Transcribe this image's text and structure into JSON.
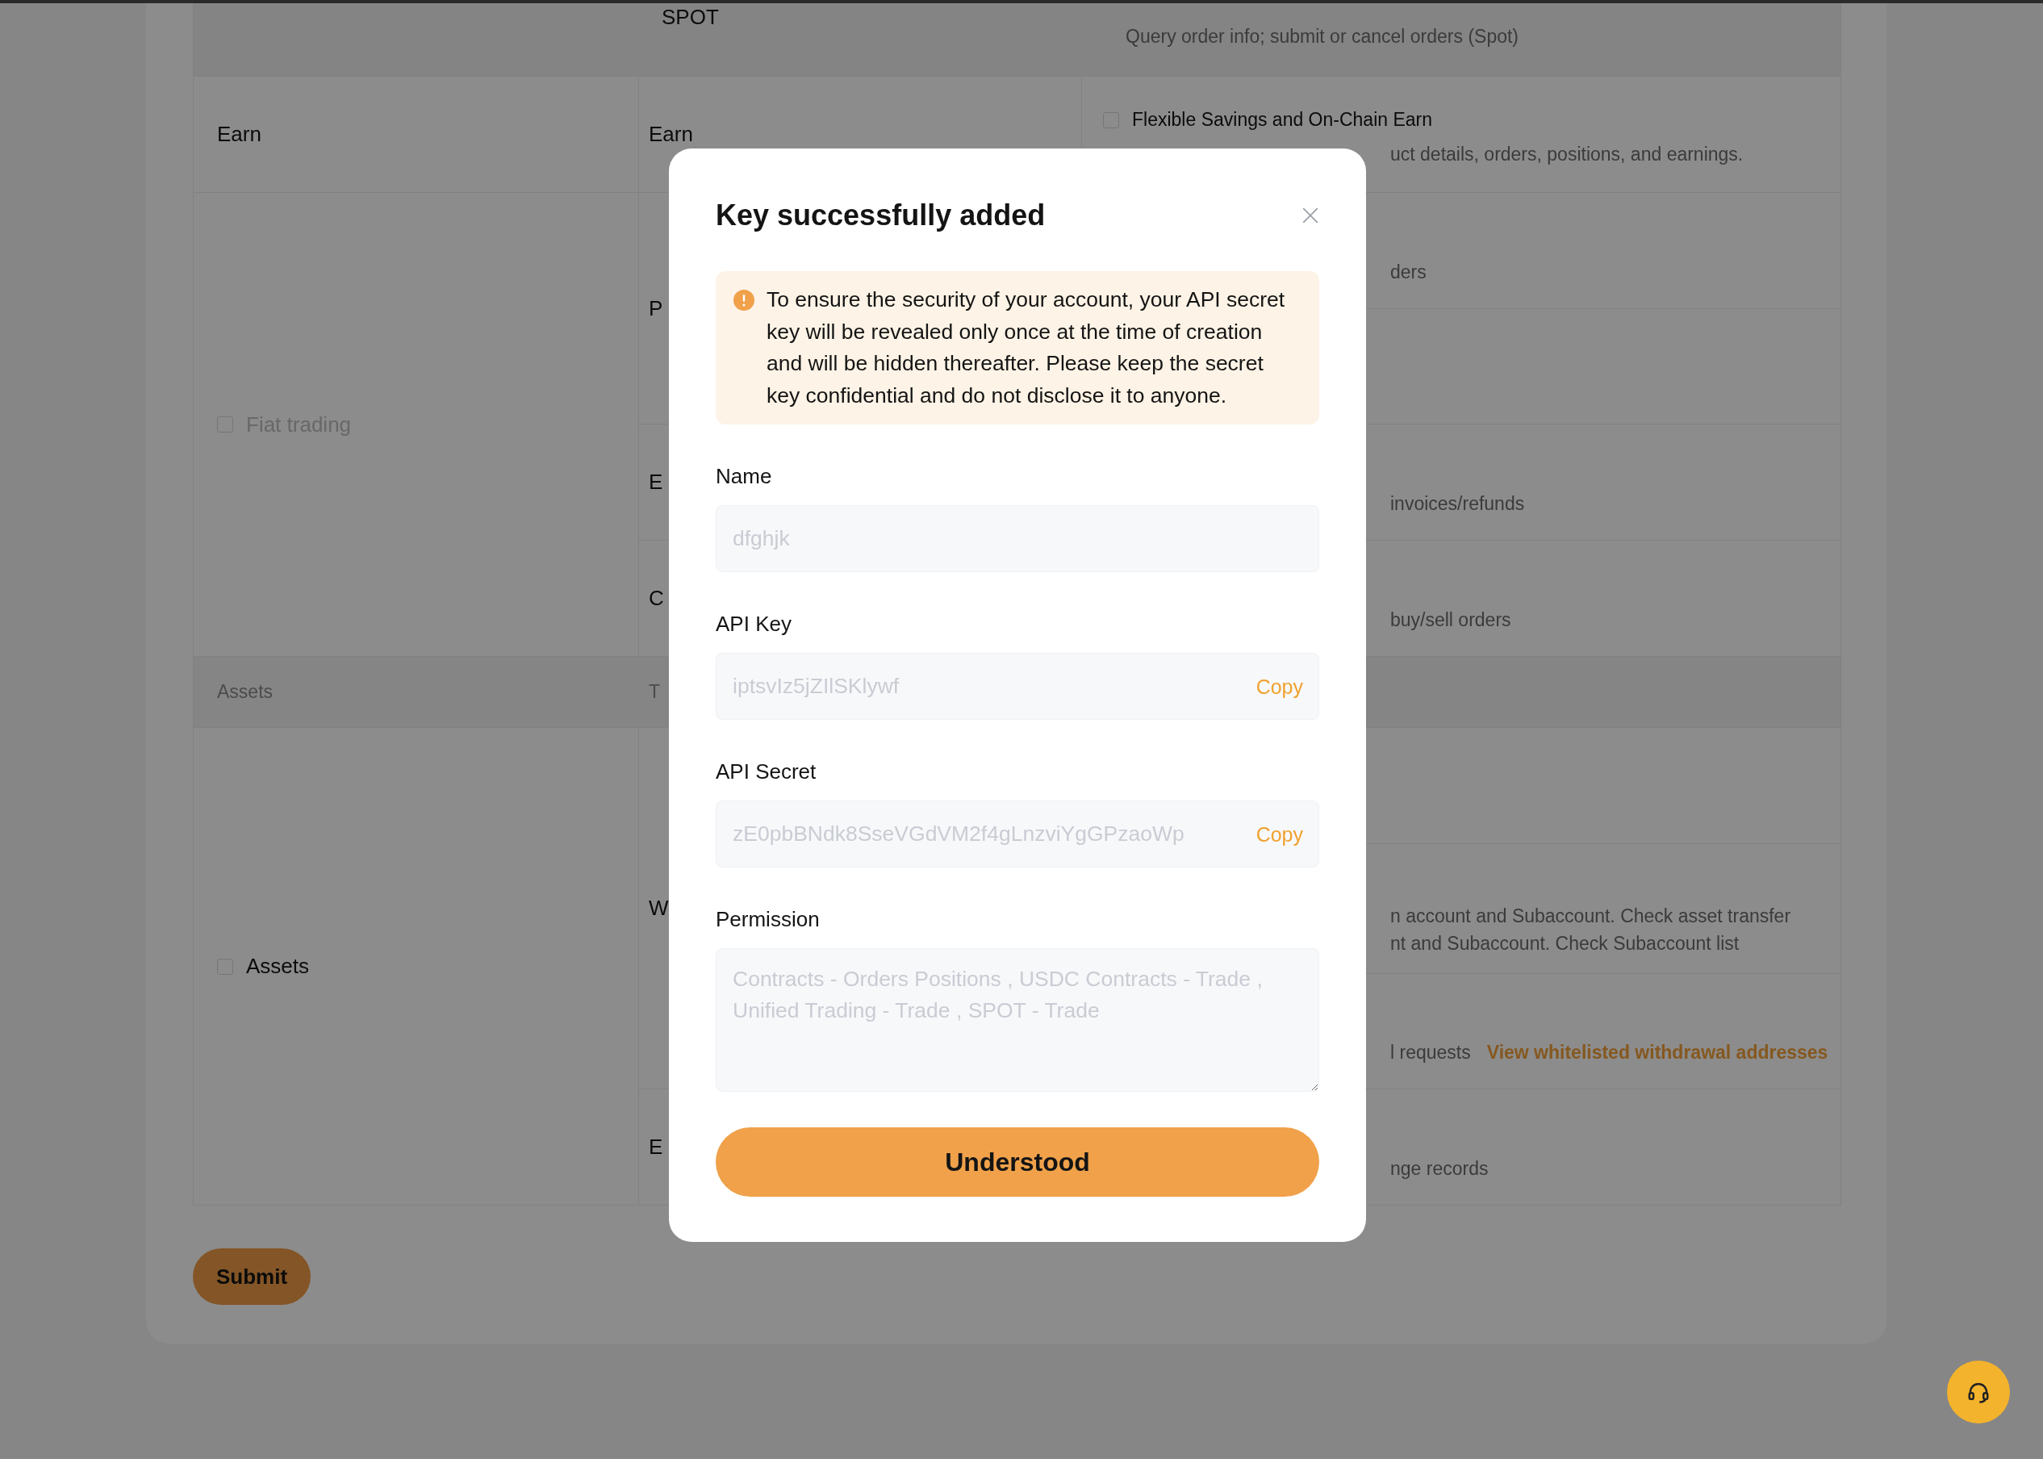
{
  "table": {
    "groups": [
      {
        "kind": "continued",
        "sub": [
          {
            "label": "SPOT",
            "items": [
              {
                "kind": "full",
                "desc": "Query order info; submit or cancel orders (Spot)"
              }
            ]
          }
        ]
      },
      {
        "kind": "group",
        "category": {
          "label": "Earn"
        },
        "sub": [
          {
            "label": "Earn",
            "items": [
              {
                "kind": "partial",
                "checkbox": {
                  "label": "Flexible Savings and On-Chain Earn",
                  "checked": false
                },
                "desc": "uct details, orders, positions, and earnings."
              }
            ]
          }
        ]
      },
      {
        "kind": "group",
        "category": {
          "label": "Fiat trading",
          "checked": false,
          "disabled": true
        },
        "sub": [
          {
            "label": "P",
            "items": [
              {
                "kind": "partial",
                "desc": "ders"
              },
              {
                "kind": "blank"
              }
            ]
          },
          {
            "label": "E",
            "items": [
              {
                "kind": "partial",
                "desc": "invoices/refunds"
              }
            ]
          },
          {
            "label": "C",
            "items": [
              {
                "kind": "partial",
                "desc": "buy/sell orders"
              }
            ]
          }
        ]
      },
      {
        "kind": "header",
        "category": {
          "label": "Assets"
        },
        "sub": [
          {
            "label": "T"
          }
        ]
      },
      {
        "kind": "group",
        "category": {
          "label": "Assets",
          "checked": false,
          "disabled": false
        },
        "sub": [
          {
            "label": "W",
            "items": [
              {
                "kind": "blank"
              },
              {
                "kind": "partial",
                "desc_lines": [
                  "n account and Subaccount. Check asset transfer",
                  "nt and Subaccount. Check Subaccount list"
                ]
              },
              {
                "kind": "partial",
                "desc": "l requests",
                "link": "View whitelisted withdrawal addresses"
              }
            ]
          },
          {
            "label": "E",
            "items": [
              {
                "kind": "partial",
                "desc": "nge records"
              }
            ]
          }
        ]
      }
    ]
  },
  "submit": "Submit",
  "dialog": {
    "title": "Key successfully added",
    "notice": "To ensure the security of your account, your API secret key will be revealed only once at the time of creation and will be hidden thereafter. Please keep the secret key confidential and do not disclose it to anyone.",
    "fields": [
      {
        "kind": "input",
        "label": "Name",
        "value": "dfghjk",
        "disabled": true
      },
      {
        "kind": "input",
        "label": "API Key",
        "value": "iptsvIz5jZIlSKlywf",
        "disabled": true,
        "action": "Copy"
      },
      {
        "kind": "input",
        "label": "API Secret",
        "value": "zE0pbBNdk8SseVGdVM2f4gLnzviYgGPzaoWp",
        "disabled": true,
        "action": "Copy"
      },
      {
        "kind": "textarea",
        "label": "Permission",
        "value": "Contracts - Orders Positions , USDC Contracts - Trade , Unified Trading - Trade , SPOT - Trade",
        "disabled": true
      }
    ],
    "button": "Understood"
  }
}
